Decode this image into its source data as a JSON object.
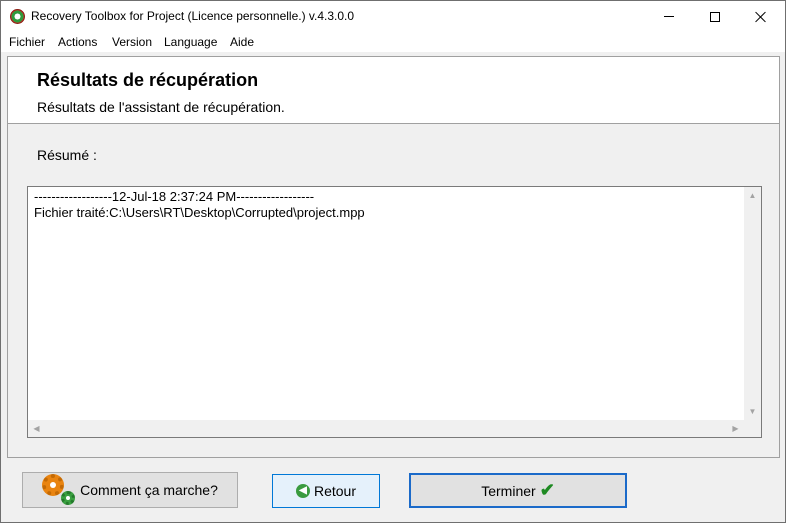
{
  "window": {
    "title": "Recovery Toolbox for Project (Licence personnelle.) v.4.3.0.0",
    "icon": "recovery-toolbox-app-icon"
  },
  "menu": {
    "items": [
      {
        "label": "Fichier"
      },
      {
        "label": "Actions"
      },
      {
        "label": "Version"
      },
      {
        "label": "Language"
      },
      {
        "label": "Aide"
      }
    ]
  },
  "header": {
    "title": "Résultats de récupération",
    "subtitle": "Résultats de l'assistant de récupération."
  },
  "summary": {
    "label": "Résumé :",
    "lines": [
      "------------------12-Jul-18 2:37:24 PM------------------",
      "Fichier traité:C:\\Users\\RT\\Desktop\\Corrupted\\project.mpp"
    ]
  },
  "buttons": {
    "how_it_works": {
      "label": "Comment ça marche?",
      "icon": "gears-icon"
    },
    "back": {
      "label": "Retour",
      "icon": "back-arrow-icon"
    },
    "finish": {
      "label": "Terminer",
      "icon": "checkmark-icon"
    }
  },
  "colors": {
    "accent": "#0078d7",
    "check": "#1e8a22",
    "gear_orange": "#e98410",
    "gear_green": "#3aa040"
  }
}
